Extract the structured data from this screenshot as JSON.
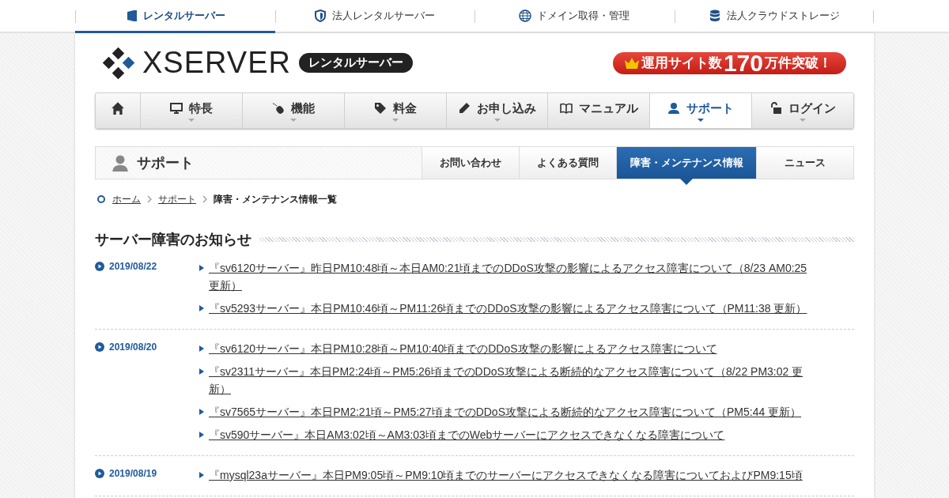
{
  "top_tabs": [
    {
      "label": "レンタルサーバー",
      "selected": true
    },
    {
      "label": "法人レンタルサーバー",
      "selected": false
    },
    {
      "label": "ドメイン取得・管理",
      "selected": false
    },
    {
      "label": "法人クラウドストレージ",
      "selected": false
    }
  ],
  "header": {
    "logo": "XSERVER",
    "badge": "レンタルサーバー",
    "promo": {
      "prefix": "運用サイト数",
      "number": "170",
      "suffix": "万件突破！"
    }
  },
  "main_nav": [
    {
      "has_menu": false,
      "selected": false
    },
    {
      "label": "特長",
      "has_menu": true,
      "selected": false
    },
    {
      "label": "機能",
      "has_menu": true,
      "selected": false
    },
    {
      "label": "料金",
      "has_menu": true,
      "selected": false
    },
    {
      "label": "お申し込み",
      "has_menu": true,
      "selected": false
    },
    {
      "label": "マニュアル",
      "has_menu": false,
      "selected": false
    },
    {
      "label": "サポート",
      "has_menu": true,
      "selected": true
    },
    {
      "label": "ログイン",
      "has_menu": true,
      "selected": false
    }
  ],
  "section": {
    "title": "サポート",
    "tabs": [
      {
        "label": "お問い合わせ",
        "selected": false
      },
      {
        "label": "よくある質問",
        "selected": false
      },
      {
        "label": "障害・メンテナンス情報",
        "selected": true
      },
      {
        "label": "ニュース",
        "selected": false
      }
    ]
  },
  "breadcrumb": [
    {
      "label": "ホーム",
      "link": true
    },
    {
      "label": "サポート",
      "link": true
    },
    {
      "label": "障害・メンテナンス情報一覧",
      "link": false
    }
  ],
  "notices": {
    "title": "サーバー障害のお知らせ",
    "groups": [
      {
        "date": "2019/08/22",
        "items": [
          "『sv6120サーバー』昨日PM10:48頃～本日AM0:21頃までのDDoS攻撃の影響によるアクセス障害について（8/23 AM0:25 更新）",
          "『sv5293サーバー』本日PM10:46頃～PM11:26頃までのDDoS攻撃の影響によるアクセス障害について（PM11:38 更新）"
        ]
      },
      {
        "date": "2019/08/20",
        "items": [
          "『sv6120サーバー』本日PM10:28頃～PM10:40頃までのDDoS攻撃の影響によるアクセス障害について",
          "『sv2311サーバー』本日PM2:24頃～PM5:26頃までのDDoS攻撃による断続的なアクセス障害について（8/22 PM3:02 更新）",
          "『sv7565サーバー』本日PM2:21頃～PM5:27頃までのDDoS攻撃による断続的なアクセス障害について（PM5:44 更新）",
          "『sv590サーバー』本日AM3:02頃～AM3:03頃までのWebサーバーにアクセスできなくなる障害について"
        ]
      },
      {
        "date": "2019/08/19",
        "items": [
          "『mysql23aサーバー』本日PM9:05頃～PM9:10頃までのサーバーにアクセスできなくなる障害についておよびPM9:15頃"
        ]
      }
    ]
  }
}
